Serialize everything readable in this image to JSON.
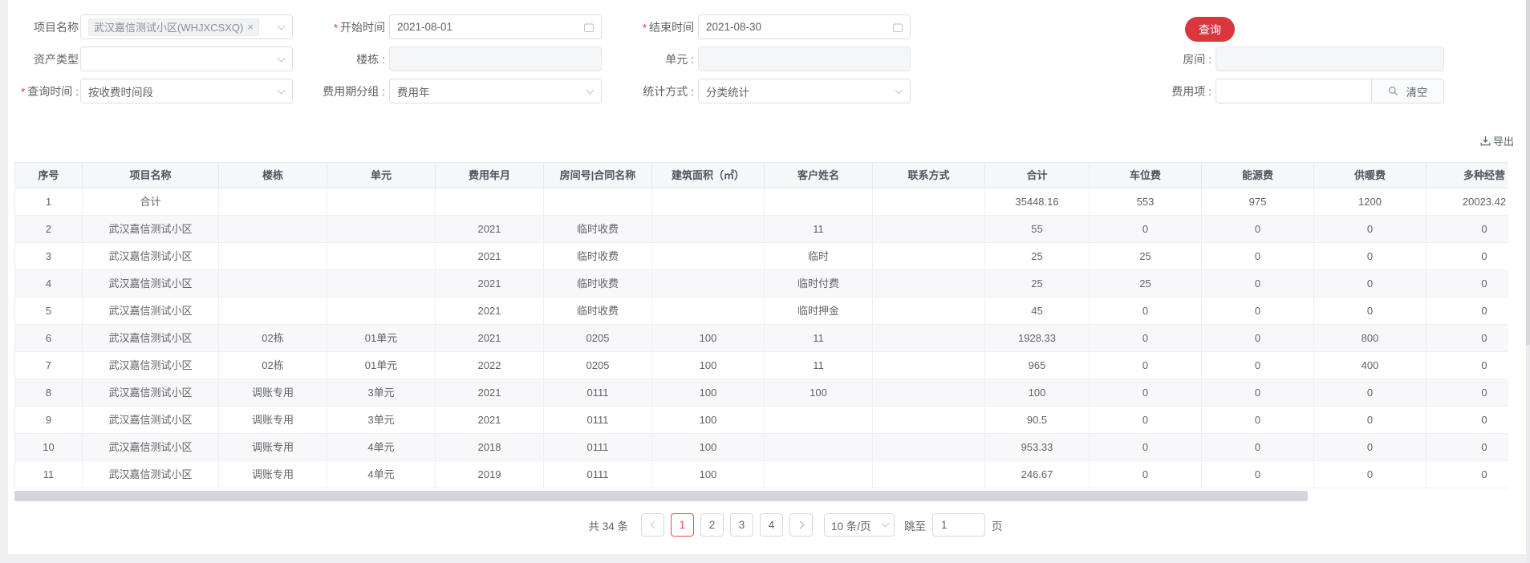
{
  "required_mark": "*",
  "filters": {
    "project_name": {
      "label": "项目名称",
      "tag": "武汉嘉信测试小区(WHJXCSXQ)",
      "tag_close": "×"
    },
    "start_time": {
      "label": "开始时间",
      "value": "2021-08-01"
    },
    "end_time": {
      "label": "结束时间",
      "value": "2021-08-30"
    },
    "search_button": "查询",
    "asset_type": {
      "label": "资产类型",
      "value": ""
    },
    "building": {
      "label": "楼栋 :",
      "value": ""
    },
    "unit": {
      "label": "单元 :",
      "value": ""
    },
    "room": {
      "label": "房间 :",
      "value": ""
    },
    "query_time": {
      "label": "查询时间 :",
      "value": "按收费时间段"
    },
    "fee_period_group": {
      "label": "费用期分组 :",
      "value": "费用年"
    },
    "stat_method": {
      "label": "统计方式 :",
      "value": "分类统计"
    },
    "fee_item": {
      "label": "费用项 :",
      "value": "",
      "clear_label": "清空"
    }
  },
  "toolbar": {
    "export_label": "导出"
  },
  "icons": {
    "chevron": "chevron-down",
    "calendar": "calendar-outline",
    "search": "magnifier",
    "download": "tray-arrow-down",
    "close": "×"
  },
  "table": {
    "columns": [
      "序号",
      "项目名称",
      "楼栋",
      "单元",
      "费用年月",
      "房间号|合同名称",
      "建筑面积（㎡）",
      "客户姓名",
      "联系方式",
      "合计",
      "车位费",
      "能源费",
      "供暖费",
      "多种经营"
    ],
    "rows": [
      [
        "1",
        "合计",
        "",
        "",
        "",
        "",
        "",
        "",
        "",
        "35448.16",
        "553",
        "975",
        "1200",
        "20023.42"
      ],
      [
        "2",
        "武汉嘉信测试小区",
        "",
        "",
        "2021",
        "临时收费",
        "",
        "11",
        "",
        "55",
        "0",
        "0",
        "0",
        "0"
      ],
      [
        "3",
        "武汉嘉信测试小区",
        "",
        "",
        "2021",
        "临时收费",
        "",
        "临时",
        "",
        "25",
        "25",
        "0",
        "0",
        "0"
      ],
      [
        "4",
        "武汉嘉信测试小区",
        "",
        "",
        "2021",
        "临时收费",
        "",
        "临时付费",
        "",
        "25",
        "25",
        "0",
        "0",
        "0"
      ],
      [
        "5",
        "武汉嘉信测试小区",
        "",
        "",
        "2021",
        "临时收费",
        "",
        "临时押金",
        "",
        "45",
        "0",
        "0",
        "0",
        "0"
      ],
      [
        "6",
        "武汉嘉信测试小区",
        "02栋",
        "01单元",
        "2021",
        "0205",
        "100",
        "11",
        "",
        "1928.33",
        "0",
        "0",
        "800",
        "0"
      ],
      [
        "7",
        "武汉嘉信测试小区",
        "02栋",
        "01单元",
        "2022",
        "0205",
        "100",
        "11",
        "",
        "965",
        "0",
        "0",
        "400",
        "0"
      ],
      [
        "8",
        "武汉嘉信测试小区",
        "调账专用",
        "3单元",
        "2021",
        "0111",
        "100",
        "100",
        "",
        "100",
        "0",
        "0",
        "0",
        "0"
      ],
      [
        "9",
        "武汉嘉信测试小区",
        "调账专用",
        "3单元",
        "2021",
        "0111",
        "100",
        "",
        "",
        "90.5",
        "0",
        "0",
        "0",
        "0"
      ],
      [
        "10",
        "武汉嘉信测试小区",
        "调账专用",
        "4单元",
        "2018",
        "0111",
        "100",
        "",
        "",
        "953.33",
        "0",
        "0",
        "0",
        "0"
      ],
      [
        "11",
        "武汉嘉信测试小区",
        "调账专用",
        "4单元",
        "2019",
        "0111",
        "100",
        "",
        "",
        "246.67",
        "0",
        "0",
        "0",
        "0"
      ]
    ]
  },
  "pagination": {
    "total_text": "共 34 条",
    "pages": [
      "1",
      "2",
      "3",
      "4"
    ],
    "active_page": "1",
    "page_size_label": "10 条/页",
    "jump_label": "跳至",
    "jump_value": "1",
    "jump_unit": "页"
  },
  "colors": {
    "primary_button": "#d9363e",
    "active_page": "#e25050"
  }
}
